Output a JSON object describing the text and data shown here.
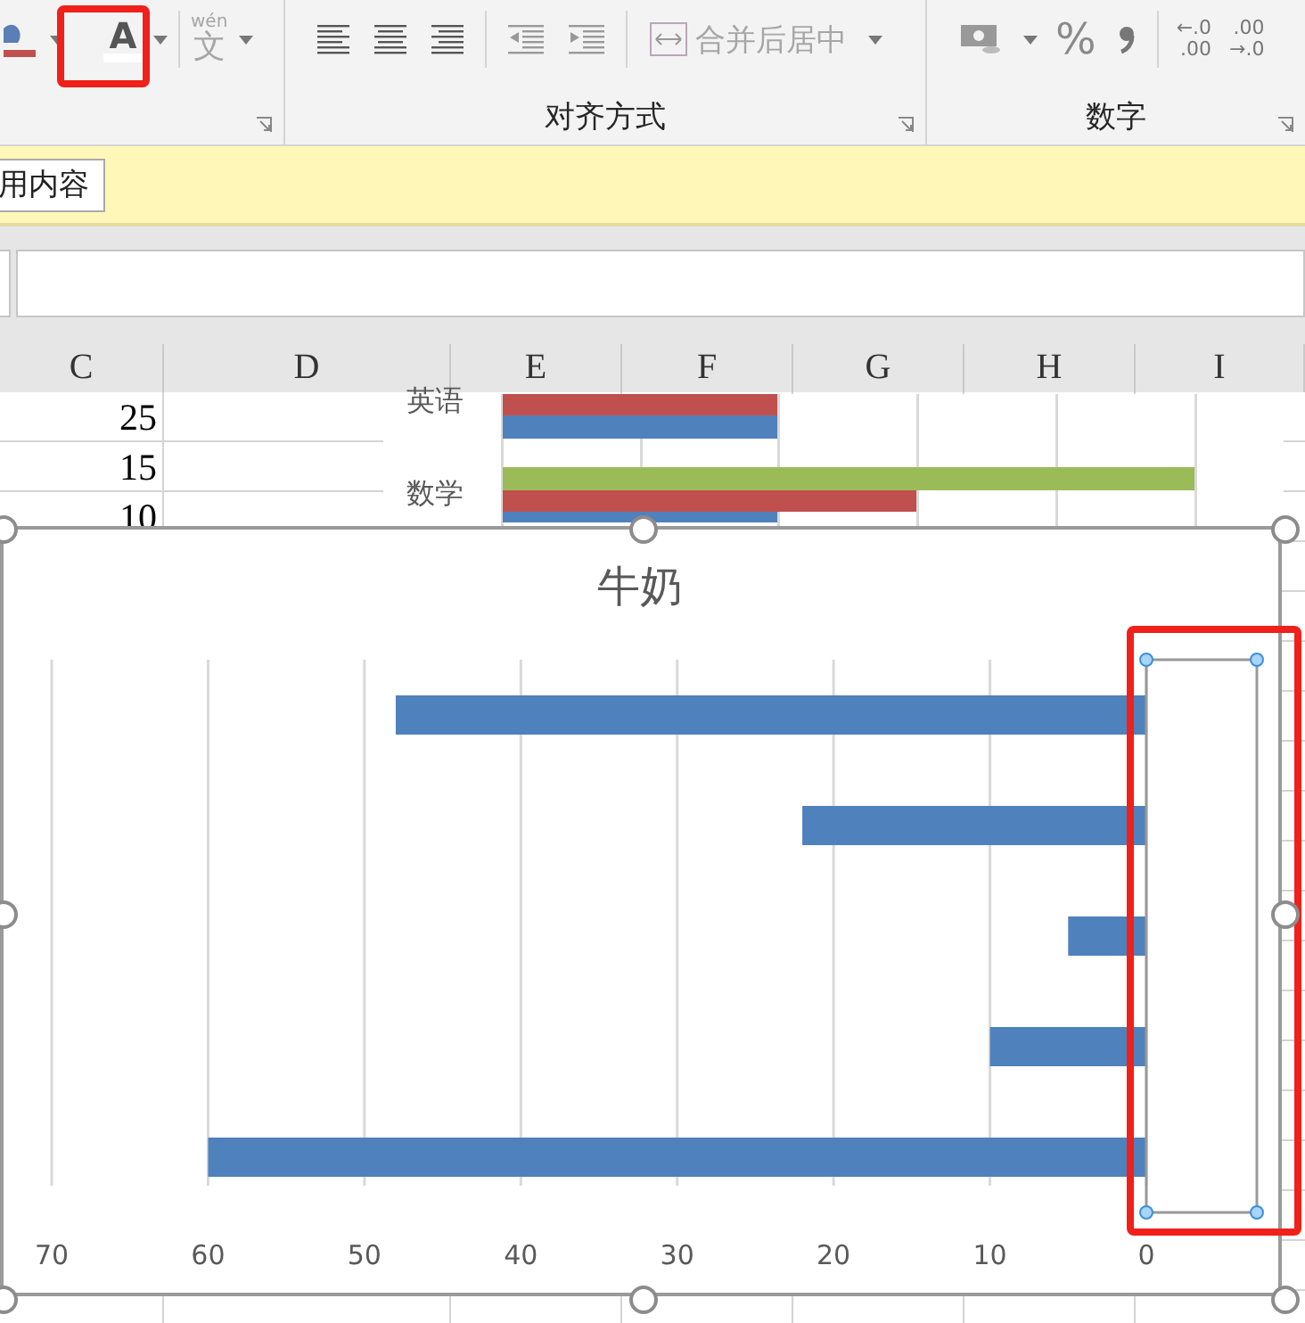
{
  "ribbon": {
    "phonetic": {
      "ruby": "wén",
      "glyph": "文",
      "disabled": true
    },
    "font_color": {
      "glyph": "A"
    },
    "alignment": {
      "merge_button": {
        "label": "合并后居中",
        "disabled": true
      },
      "label": "对齐方式"
    },
    "number": {
      "percent": "%",
      "increase_decimal": {
        "top": "←.0",
        "bottom": ".00"
      },
      "decrease_decimal": {
        "top": ".00",
        "bottom": "→.0"
      },
      "label": "数字"
    }
  },
  "message_bar": {
    "button": "用内容"
  },
  "sheet": {
    "columns": [
      "C",
      "D",
      "E",
      "F",
      "G",
      "H",
      "I"
    ],
    "rows": [
      [
        "25"
      ],
      [
        "15"
      ],
      [
        "10"
      ]
    ]
  },
  "embedded_chart": {
    "categories": [
      "英语",
      "数学"
    ]
  },
  "chart": {
    "chart_data": {
      "type": "bar",
      "orientation": "horizontal",
      "title": "牛奶",
      "grid": true,
      "series": [
        {
          "color": "#4f81bd",
          "values": [
            48,
            22,
            5,
            10,
            60
          ]
        }
      ],
      "xlim": [
        70,
        0
      ],
      "xticks": [
        70,
        60,
        50,
        40,
        30,
        20,
        10,
        0
      ]
    },
    "axis_selected": true
  }
}
